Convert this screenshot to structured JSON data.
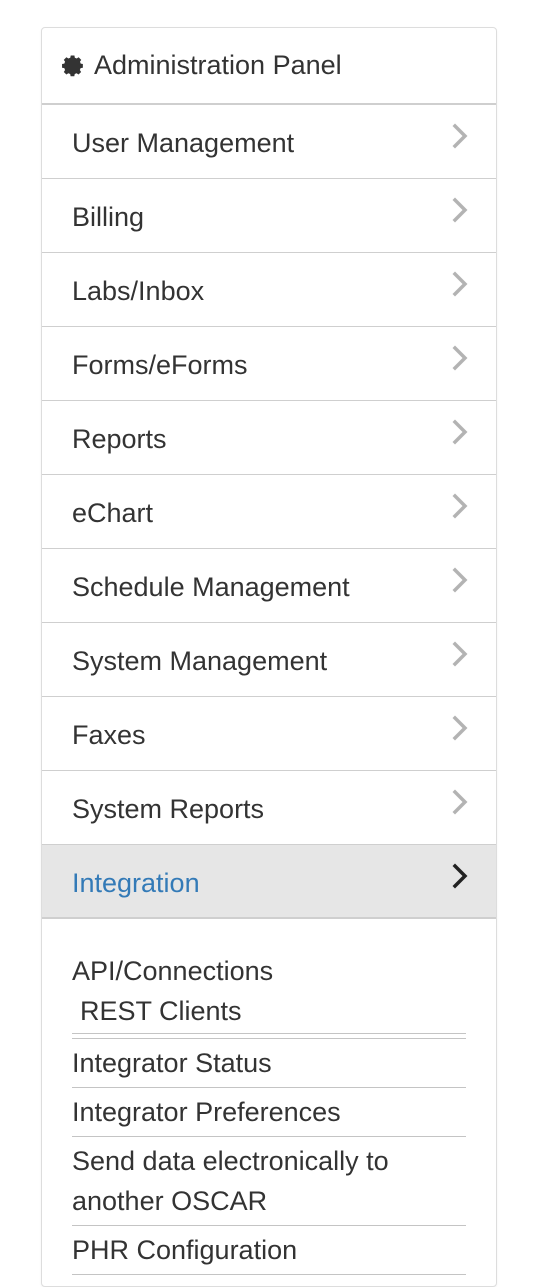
{
  "panel": {
    "title": "Administration Panel",
    "title_icon": "gear-icon"
  },
  "menu": [
    {
      "label": "User Management",
      "icon": "chevron-right-icon"
    },
    {
      "label": "Billing",
      "icon": "chevron-right-icon"
    },
    {
      "label": "Labs/Inbox",
      "icon": "chevron-right-icon"
    },
    {
      "label": "Forms/eForms",
      "icon": "chevron-right-icon"
    },
    {
      "label": "Reports",
      "icon": "chevron-right-icon"
    },
    {
      "label": "eChart",
      "icon": "chevron-right-icon"
    },
    {
      "label": "Schedule Management",
      "icon": "chevron-right-icon"
    },
    {
      "label": "System Management",
      "icon": "chevron-right-icon"
    },
    {
      "label": "Faxes",
      "icon": "chevron-right-icon"
    },
    {
      "label": "System Reports",
      "icon": "chevron-right-icon"
    },
    {
      "label": "Integration",
      "icon": "chevron-right-icon",
      "active": true
    }
  ],
  "submenu": {
    "group_heading": "API/Connections",
    "group_items": [
      "REST Clients"
    ],
    "items": [
      "Integrator Status",
      "Integrator Preferences",
      "Send data electronically to another OSCAR",
      "PHR Configuration"
    ]
  },
  "colors": {
    "active_text": "#337ab7",
    "active_bg": "#e6e6e6",
    "text": "#333333",
    "border": "#cfcfcf"
  }
}
